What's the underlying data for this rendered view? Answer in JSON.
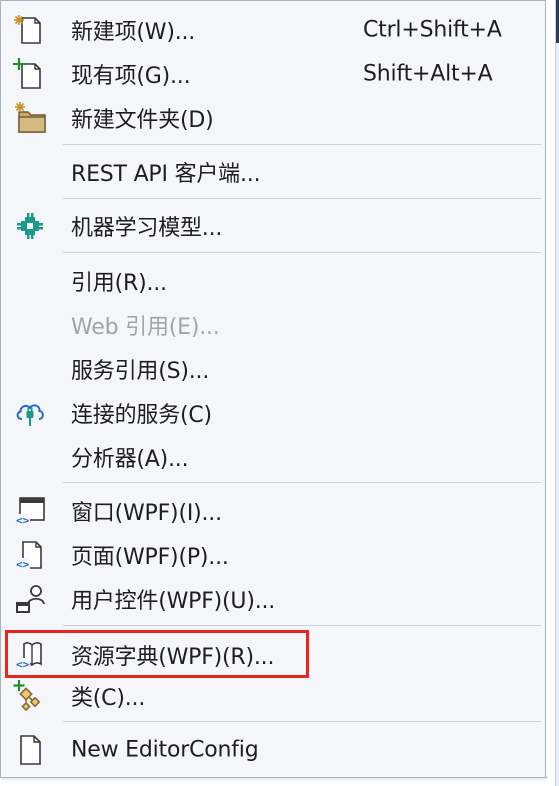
{
  "menu": {
    "items": [
      {
        "label": "新建项(W)...",
        "shortcut": "Ctrl+Shift+A",
        "icon": "new-item-icon",
        "enabled": true
      },
      {
        "label": "现有项(G)...",
        "shortcut": "Shift+Alt+A",
        "icon": "existing-item-icon",
        "enabled": true
      },
      {
        "label": "新建文件夹(D)",
        "shortcut": "",
        "icon": "new-folder-icon",
        "enabled": true
      },
      {
        "label": "REST API 客户端...",
        "shortcut": "",
        "icon": "",
        "enabled": true
      },
      {
        "label": "机器学习模型...",
        "shortcut": "",
        "icon": "ml-model-icon",
        "enabled": true
      },
      {
        "label": "引用(R)...",
        "shortcut": "",
        "icon": "",
        "enabled": true
      },
      {
        "label": "Web 引用(E)...",
        "shortcut": "",
        "icon": "",
        "enabled": false
      },
      {
        "label": "服务引用(S)...",
        "shortcut": "",
        "icon": "",
        "enabled": true
      },
      {
        "label": "连接的服务(C)",
        "shortcut": "",
        "icon": "connected-service-cloud-icon",
        "enabled": true
      },
      {
        "label": "分析器(A)...",
        "shortcut": "",
        "icon": "",
        "enabled": true
      },
      {
        "label": "窗口(WPF)(I)...",
        "shortcut": "",
        "icon": "wpf-window-icon",
        "enabled": true
      },
      {
        "label": "页面(WPF)(P)...",
        "shortcut": "",
        "icon": "wpf-page-icon",
        "enabled": true
      },
      {
        "label": "用户控件(WPF)(U)...",
        "shortcut": "",
        "icon": "wpf-user-control-icon",
        "enabled": true
      },
      {
        "label": "资源字典(WPF)(R)...",
        "shortcut": "",
        "icon": "resource-dictionary-icon",
        "enabled": true,
        "highlighted": true
      },
      {
        "label": "类(C)...",
        "shortcut": "",
        "icon": "add-class-icon",
        "enabled": true
      },
      {
        "label": "New EditorConfig",
        "shortcut": "",
        "icon": "editorconfig-file-icon",
        "enabled": true
      }
    ]
  },
  "colors": {
    "menu_background": "#f5f6f9",
    "text": "#1e1e1e",
    "disabled_text": "#a2a4a8",
    "icon_accent_blue": "#1b6ac9",
    "icon_green": "#1e8f2a",
    "icon_teal": "#1a9a8a",
    "folder_tan": "#c8a96a",
    "highlight_box": "#e8261b"
  }
}
